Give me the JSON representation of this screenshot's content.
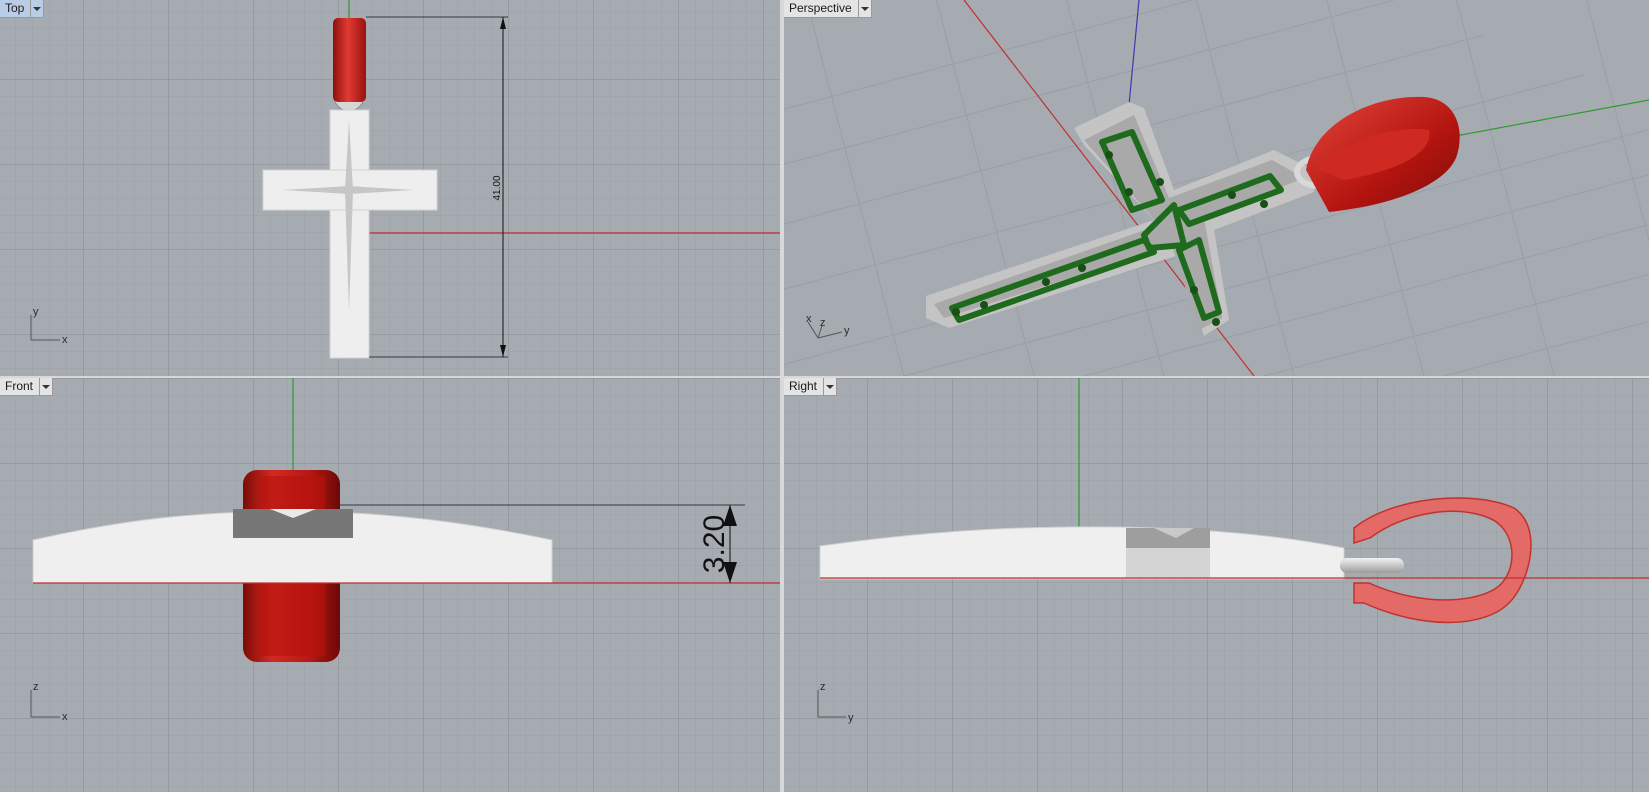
{
  "viewports": {
    "top": {
      "label": "Top",
      "active": true,
      "dimension": "41.00",
      "triad": {
        "vertical": "y",
        "horizontal": "x"
      }
    },
    "perspective": {
      "label": "Perspective",
      "triad": {
        "a": "x",
        "b": "z",
        "c": "y"
      }
    },
    "front": {
      "label": "Front",
      "dimension": "3.20",
      "triad": {
        "vertical": "z",
        "horizontal": "x"
      }
    },
    "right": {
      "label": "Right",
      "triad": {
        "vertical": "z",
        "horizontal": "y"
      }
    }
  },
  "colors": {
    "viewport_bg": "#a6abb2",
    "grid_minor": "#9aa0a7",
    "grid_major": "#8a9098",
    "x_axis": "#c0302c",
    "y_axis": "#2f9a2f",
    "z_axis": "#3a3aa8",
    "model_white": "#eeeeee",
    "bail_red": "#c8201c",
    "selection_green": "#1e6b1e",
    "active_label": "#b9cde6"
  }
}
